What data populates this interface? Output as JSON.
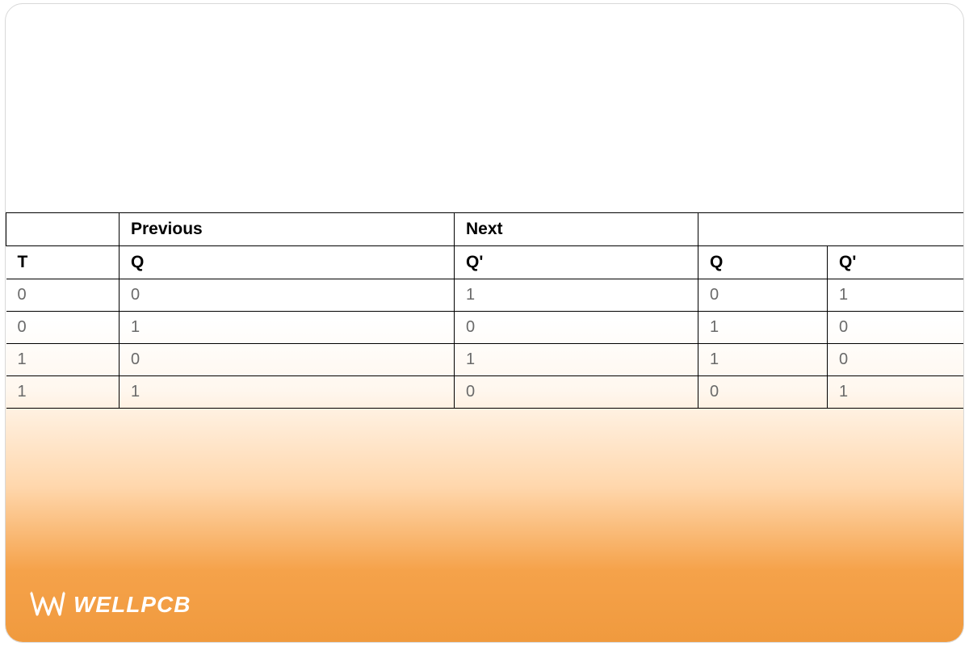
{
  "table": {
    "group_headers": [
      "",
      "Previous",
      "Next",
      ""
    ],
    "headers": [
      "T",
      "Q",
      "Q'",
      "Q",
      "Q'"
    ],
    "rows": [
      [
        "0",
        "0",
        "1",
        "0",
        "1"
      ],
      [
        "0",
        "1",
        "0",
        "1",
        "0"
      ],
      [
        "1",
        "0",
        "1",
        "1",
        "0"
      ],
      [
        "1",
        "1",
        "0",
        "0",
        "1"
      ]
    ]
  },
  "brand": {
    "name": "WELLPCB"
  }
}
